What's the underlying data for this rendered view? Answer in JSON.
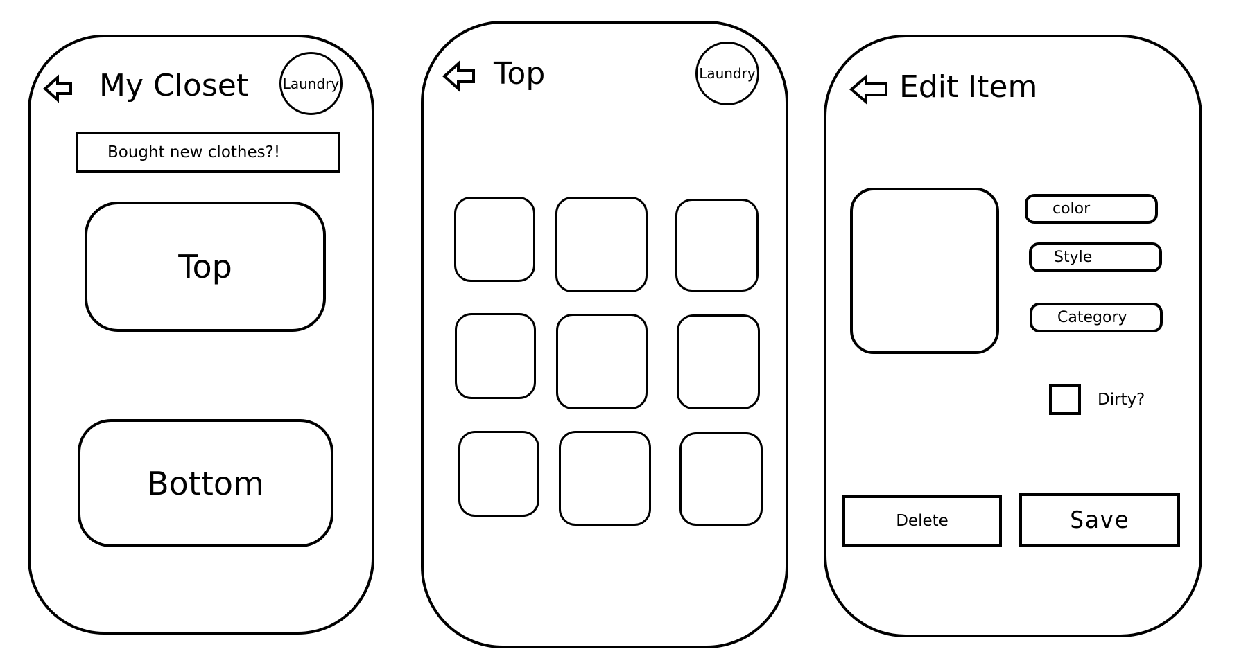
{
  "closet_screen": {
    "title": "My Closet",
    "laundry_label": "Laundry",
    "banner_text": "Bought new clothes?!",
    "top_label": "Top",
    "bottom_label": "Bottom"
  },
  "top_screen": {
    "title": "Top",
    "laundry_label": "Laundry",
    "tile_count": 9
  },
  "edit_screen": {
    "title": "Edit Item",
    "fields": {
      "color": "color",
      "style": "Style",
      "category": "Category"
    },
    "dirty_label": "Dirty?",
    "delete_label": "Delete",
    "save_label": "Save"
  },
  "icons": {
    "back": "back-arrow-icon"
  }
}
